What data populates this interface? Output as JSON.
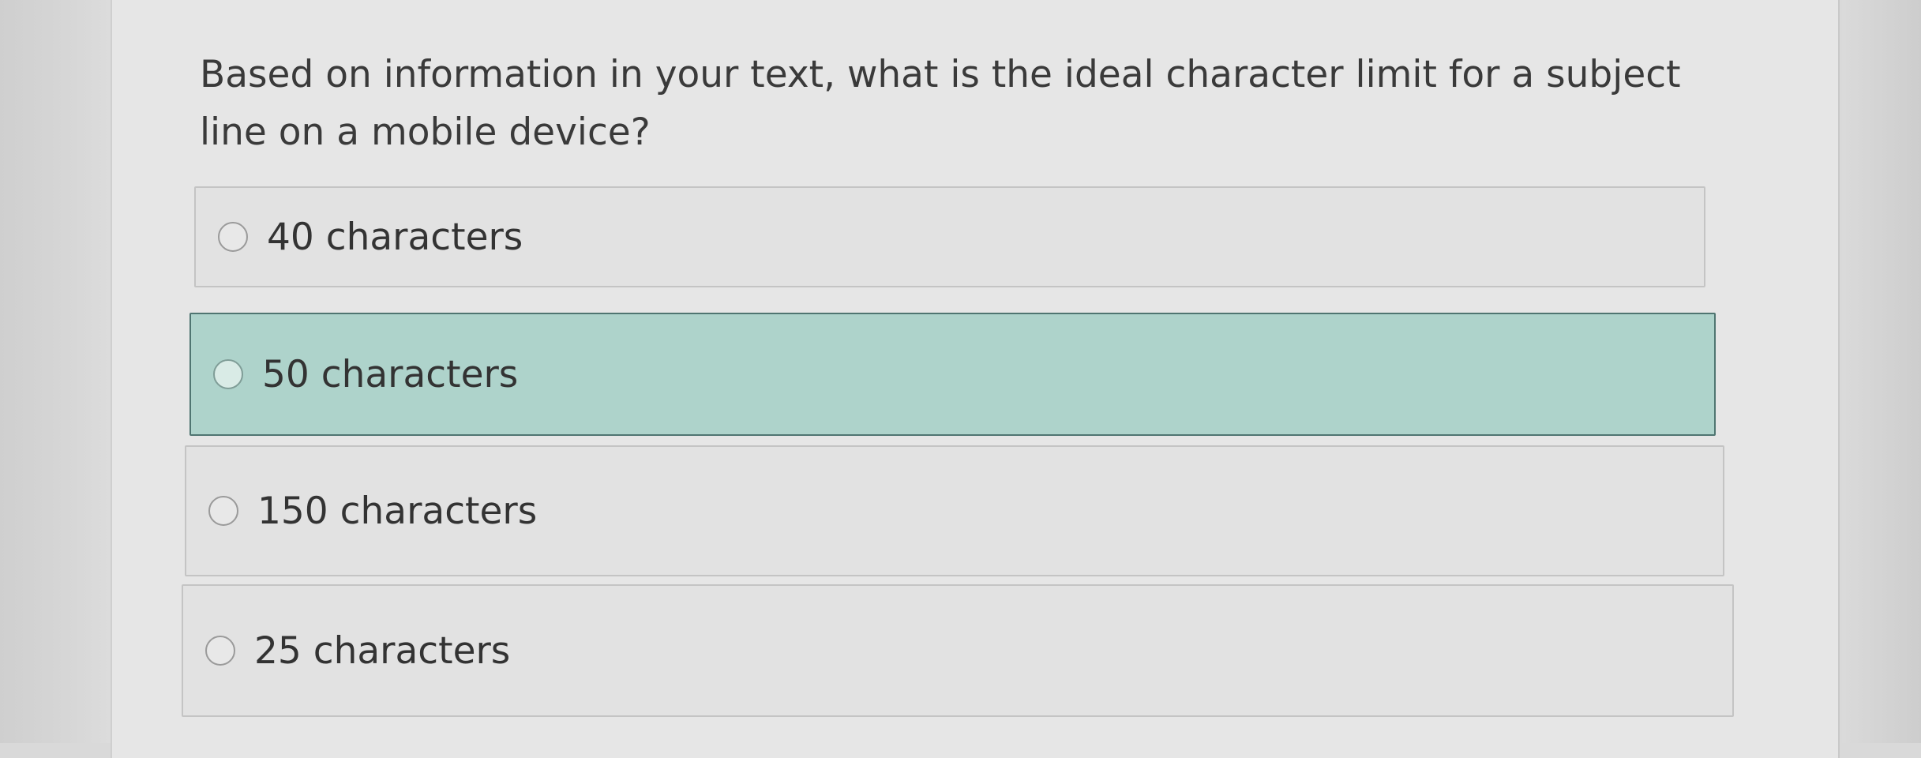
{
  "question": {
    "text": "Based on information in your text, what is the ideal character limit for a subject line on a mobile device?"
  },
  "choices": [
    {
      "label": "40 characters",
      "selected": false
    },
    {
      "label": "50 characters",
      "selected": true
    },
    {
      "label": "150 characters",
      "selected": false
    },
    {
      "label": "25 characters",
      "selected": false
    }
  ],
  "colors": {
    "selected_background": "#aed3cb",
    "selected_border": "#4f7571",
    "option_background": "#e2e2e2",
    "text": "#333333"
  },
  "icons": {
    "radio": "radio-button-icon"
  }
}
